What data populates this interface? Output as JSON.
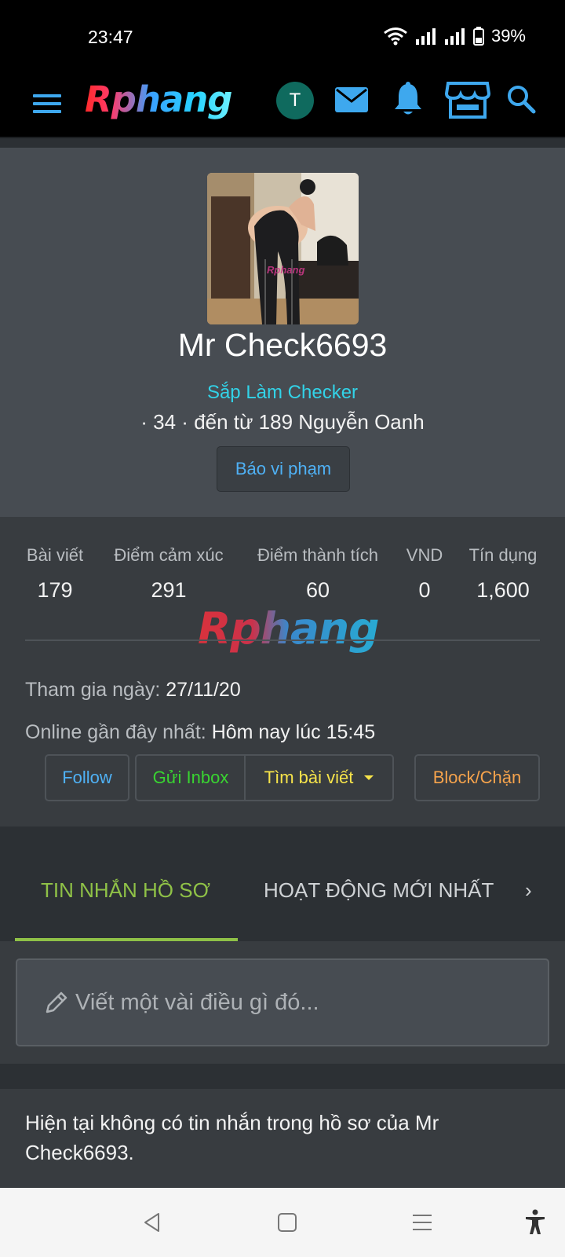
{
  "status_bar": {
    "time": "23:47",
    "battery": "39%"
  },
  "header": {
    "logo_text": "Rphang",
    "avatar_initial": "T"
  },
  "profile": {
    "username": "Mr Check6693",
    "user_title": "Sắp Làm Checker",
    "info": "· 34 · đến từ 189 Nguyễn Oanh",
    "photo_watermark": "Rphang",
    "report_label": "Báo vi phạm"
  },
  "stats": [
    {
      "label": "Bài viết",
      "value": "179"
    },
    {
      "label": "Điểm cảm xúc",
      "value": "291"
    },
    {
      "label": "Điểm thành tích",
      "value": "60"
    },
    {
      "label": "VND",
      "value": "0"
    },
    {
      "label": "Tín dụng",
      "value": "1,600"
    }
  ],
  "watermark": "Rphang",
  "joined": {
    "label": "Tham gia ngày:",
    "value": "27/11/20"
  },
  "last_online": {
    "label": "Online gần đây nhất:",
    "value": "Hôm nay lúc 15:45"
  },
  "actions": {
    "follow": "Follow",
    "inbox": "Gửi Inbox",
    "find_posts": "Tìm bài viết",
    "block": "Block/Chặn"
  },
  "tabs": {
    "profile_posts": "TIN NHẮN HỒ SƠ",
    "latest_activity": "HOẠT ĐỘNG MỚI NHẤT",
    "next": "›"
  },
  "composer": {
    "placeholder": "Viết một vài điều gì đó..."
  },
  "empty_message": "Hiện tại không có tin nhắn trong hồ sơ của Mr Check6693.",
  "colors": {
    "accent_green": "#8fc147",
    "link_blue": "#4fb1f5",
    "title_cyan": "#32d3e8"
  }
}
